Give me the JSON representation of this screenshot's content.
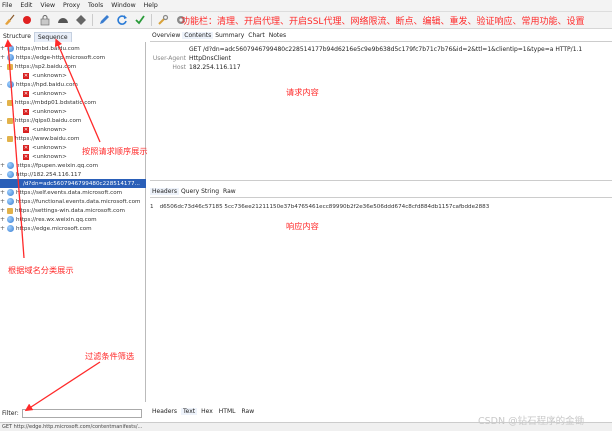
{
  "menu": [
    "File",
    "Edit",
    "View",
    "Proxy",
    "Tools",
    "Window",
    "Help"
  ],
  "toolbar": {
    "note": "功能栏：清理、开启代理、开启SSL代理、网络限流、断点、编辑、重发、验证响应、常用功能、设置",
    "icons": [
      "broom-icon",
      "record-icon",
      "ssl-lock-icon",
      "throttle-icon",
      "breakpoint-icon",
      "edit-pencil-icon",
      "repeat-icon",
      "validate-check-icon",
      "tools-icon",
      "settings-gear-icon"
    ]
  },
  "left_tabs": [
    "Structure",
    "Sequence"
  ],
  "tree": [
    {
      "text": "https://mbd.baidu.com",
      "icon": "globe",
      "exp": "+"
    },
    {
      "text": "https://edge-http.microsoft.com",
      "icon": "globe",
      "exp": "+"
    },
    {
      "text": "https://sp2.baidu.com",
      "icon": "lock",
      "exp": "-"
    },
    {
      "text": "<unknown>",
      "icon": "x",
      "exp": "",
      "sub": true
    },
    {
      "text": "https://hpd.baidu.com",
      "icon": "globe",
      "exp": "-"
    },
    {
      "text": "<unknown>",
      "icon": "x",
      "exp": "",
      "sub": true
    },
    {
      "text": "https://mbdp01.bdstatic.com",
      "icon": "lock",
      "exp": "-"
    },
    {
      "text": "<unknown>",
      "icon": "x",
      "exp": "",
      "sub": true
    },
    {
      "text": "https://qips0.baidu.com",
      "icon": "lock",
      "exp": "-"
    },
    {
      "text": "<unknown>",
      "icon": "x",
      "exp": "",
      "sub": true
    },
    {
      "text": "https://www.baidu.com",
      "icon": "lock",
      "exp": "-"
    },
    {
      "text": "<unknown>",
      "icon": "x",
      "exp": "",
      "sub": true
    },
    {
      "text": "<unknown>",
      "icon": "x",
      "exp": "",
      "sub": true
    },
    {
      "text": "https://fpupen.weixin.qq.com",
      "icon": "globe",
      "exp": "+"
    },
    {
      "text": "http://182.254.116.117",
      "icon": "globe",
      "exp": "-"
    },
    {
      "text": "/d?dn=adc5607946799480c228514177...",
      "icon": "none",
      "exp": "",
      "sub": true,
      "selected": true
    },
    {
      "text": "https://self.events.data.microsoft.com",
      "icon": "globe",
      "exp": "+"
    },
    {
      "text": "https://functional.events.data.microsoft.com",
      "icon": "globe",
      "exp": "+"
    },
    {
      "text": "https://settings-win.data.microsoft.com",
      "icon": "lock",
      "exp": "+"
    },
    {
      "text": "https://res.wx.weixin.qq.com",
      "icon": "globe",
      "exp": "+"
    },
    {
      "text": "https://edge.microsoft.com",
      "icon": "globe",
      "exp": "+"
    }
  ],
  "filter": {
    "label": "Filter:",
    "value": ""
  },
  "status_text": "GET http://edge.http.microsoft.com/contentmanifests/...",
  "top_tabs": [
    "Overview",
    "Contents",
    "Summary",
    "Chart",
    "Notes"
  ],
  "request": {
    "line": "GET /d?dn=adc5607946799480c228514177b94d6216e5c9e9b638d5c179fc7b71c7b76&id=2&ttl=1&clientip=1&type=a HTTP/1.1",
    "user_agent_label": "User-Agent",
    "user_agent": "HttpDnsClient",
    "host_label": "Host",
    "host": "182.254.116.117"
  },
  "resp_tabs": [
    "Headers",
    "Query String",
    "Raw"
  ],
  "response": {
    "line_no": "1",
    "text": "d6506dc73d46c57185 5cc736ee21211150e37b4765461ecc89990b2f2e36e506ddd674c8cfd884db1157cafbdde2883"
  },
  "bottom_tabs": [
    "Headers",
    "Text",
    "Hex",
    "HTML",
    "Raw"
  ],
  "annotations": {
    "request_content": "请求内容",
    "response_content": "响应内容",
    "sequence_note": "按照请求顺序展示",
    "domain_note": "根据域名分类展示",
    "filter_note": "过滤条件筛选"
  },
  "watermark": "CSDN @钻石程序的金锄",
  "colors": {
    "annotation": "#ff2a2a",
    "selection": "#2a5fb8",
    "accent": "#3a7dd0"
  }
}
